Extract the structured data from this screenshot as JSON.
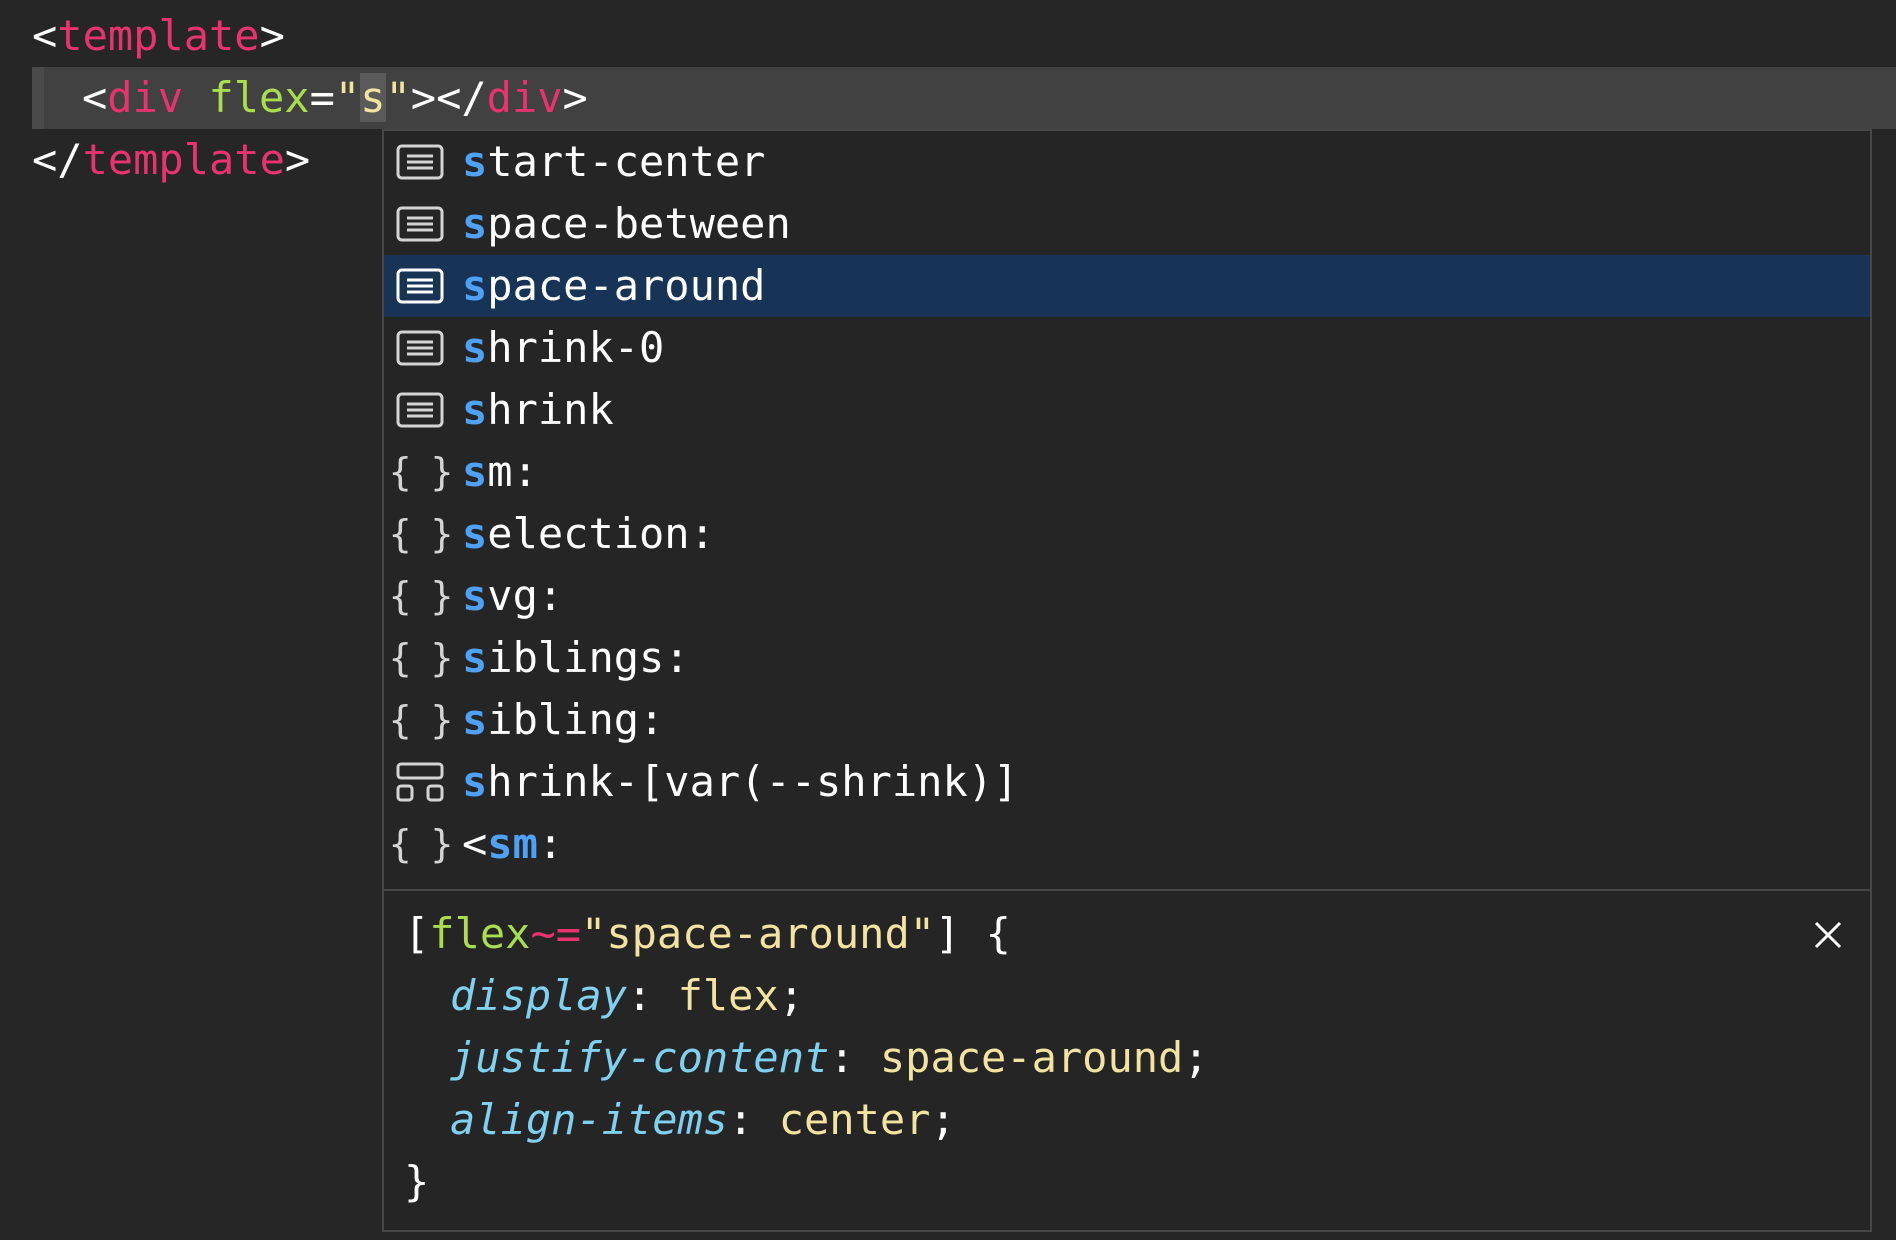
{
  "editor": {
    "line1": {
      "open": "<",
      "tag": "template",
      "close": ">"
    },
    "line2": {
      "open": "<",
      "tag": "div",
      "space": " ",
      "attr": "flex",
      "eq": "=",
      "quote1": "\"",
      "value": "s",
      "quote2": "\"",
      "mid": "></",
      "tag_end": "div",
      "close": ">"
    },
    "line3": {
      "open": "</",
      "tag": "template",
      "close": ">"
    }
  },
  "suggestions": [
    {
      "icon": "text-list-icon",
      "match": "s",
      "rest": "tart-center",
      "selected": false
    },
    {
      "icon": "text-list-icon",
      "match": "s",
      "rest": "pace-between",
      "selected": false
    },
    {
      "icon": "text-list-icon",
      "match": "s",
      "rest": "pace-around",
      "selected": true
    },
    {
      "icon": "text-list-icon",
      "match": "s",
      "rest": "hrink-0",
      "selected": false
    },
    {
      "icon": "text-list-icon",
      "match": "s",
      "rest": "hrink",
      "selected": false
    },
    {
      "icon": "braces-icon",
      "match": "s",
      "rest": "m:",
      "selected": false
    },
    {
      "icon": "braces-icon",
      "match": "s",
      "rest": "election:",
      "selected": false
    },
    {
      "icon": "braces-icon",
      "match": "s",
      "rest": "vg:",
      "selected": false
    },
    {
      "icon": "braces-icon",
      "match": "s",
      "rest": "iblings:",
      "selected": false
    },
    {
      "icon": "braces-icon",
      "match": "s",
      "rest": "ibling:",
      "selected": false
    },
    {
      "icon": "layout-blocks-icon",
      "match": "s",
      "rest": "hrink-[var(--shrink)]",
      "selected": false
    },
    {
      "icon": "braces-icon",
      "prefix": "<",
      "match": "sm",
      "rest": ":",
      "selected": false
    }
  ],
  "detail": {
    "selector_open": "[",
    "selector_attr": "flex",
    "selector_op": "~=",
    "selector_value": "\"space-around\"",
    "selector_close": "] {",
    "props": [
      {
        "name": "display",
        "sep": ": ",
        "value": "flex",
        "end": ";"
      },
      {
        "name": "justify-content",
        "sep": ": ",
        "value": "space-around",
        "end": ";"
      },
      {
        "name": "align-items",
        "sep": ": ",
        "value": "center",
        "end": ";"
      }
    ],
    "block_close": "}",
    "close_icon": "close-icon"
  }
}
